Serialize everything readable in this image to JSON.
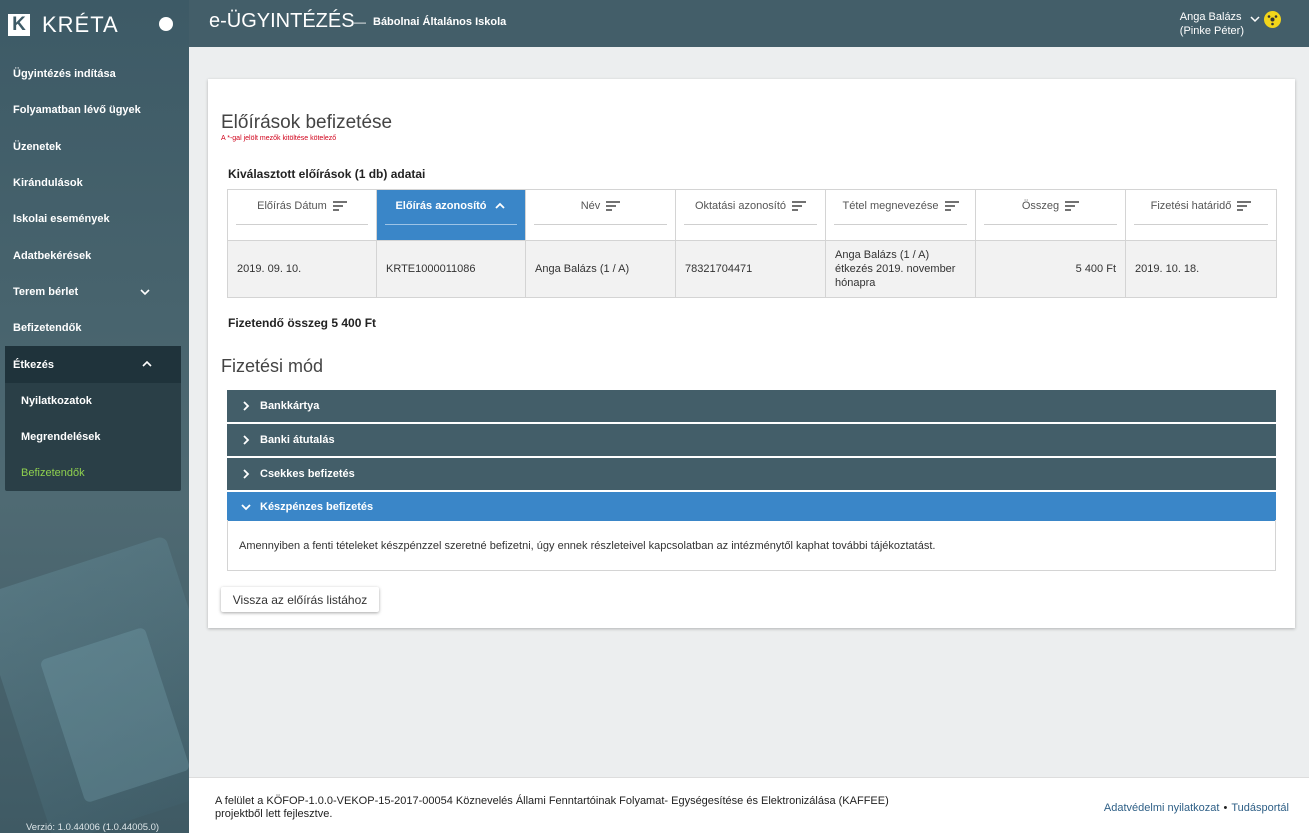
{
  "brand": {
    "name": "KRÉTA",
    "logo_letter": "K"
  },
  "sidebar": {
    "items": [
      {
        "label": "Ügyintézés indítása"
      },
      {
        "label": "Folyamatban lévő ügyek"
      },
      {
        "label": "Üzenetek"
      },
      {
        "label": "Kirándulások"
      },
      {
        "label": "Iskolai események"
      },
      {
        "label": "Adatbekérések"
      },
      {
        "label": "Terem bérlet"
      },
      {
        "label": "Befizetendők"
      }
    ],
    "group": {
      "label": "Étkezés",
      "subitems": [
        {
          "label": "Nyilatkozatok"
        },
        {
          "label": "Megrendelések"
        },
        {
          "label": "Befizetendők"
        }
      ]
    },
    "version": "Verzió: 1.0.44006 (1.0.44005.0)"
  },
  "header": {
    "app_title": "e-ÜGYINTÉZÉS",
    "separator": "—",
    "school": "Bábolnai Általános Iskola",
    "user_name": "Anga Balázs",
    "user_sub": "(Pinke Péter)"
  },
  "main": {
    "page_title": "Előírások befizetése",
    "required_note": "A *-gal jelölt mezők kitöltése kötelező",
    "section_title": "Kiválasztott előírások (1 db) adatai",
    "table": {
      "headers": [
        "Előírás Dátum",
        "Előírás azonosító",
        "Név",
        "Oktatási azonosító",
        "Tétel megnevezése",
        "Összeg",
        "Fizetési határidő"
      ],
      "sorted_column": 1,
      "rows": [
        [
          "2019. 09. 10.",
          "KRTE1000011086",
          "Anga Balázs (1 / A)",
          "78321704471",
          "Anga Balázs (1 / A) étkezés 2019. november hónapra",
          "5 400 Ft",
          "2019. 10. 18."
        ]
      ]
    },
    "total": "Fizetendő összeg 5 400 Ft",
    "payment_title": "Fizetési mód",
    "payment_options": [
      {
        "label": "Bankkártya",
        "open": false
      },
      {
        "label": "Banki átutalás",
        "open": false
      },
      {
        "label": "Csekkes befizetés",
        "open": false
      },
      {
        "label": "Készpénzes befizetés",
        "open": true
      }
    ],
    "cash_text": "Amennyiben a fenti tételeket készpénzzel szeretné befizetni, úgy ennek részleteivel kapcsolatban az intézménytől kaphat további tájékoztatást.",
    "back_button": "Vissza az előírás listához"
  },
  "footer": {
    "text": "A felület a KÖFOP-1.0.0-VEKOP-15-2017-00054 Köznevelés Állami Fenntartóinak Folyamat- Egységesítése és Elektronizálása (KAFFEE) projektből lett fejlesztve.",
    "link_privacy": "Adatvédelmi nyilatkozat",
    "link_dot": "•",
    "link_knowledge": "Tudásportál"
  },
  "colors": {
    "sidebar": "#435e69",
    "accent_blue": "#3a86c8",
    "active_green": "#8fd14f",
    "required_red": "#d0021b"
  }
}
